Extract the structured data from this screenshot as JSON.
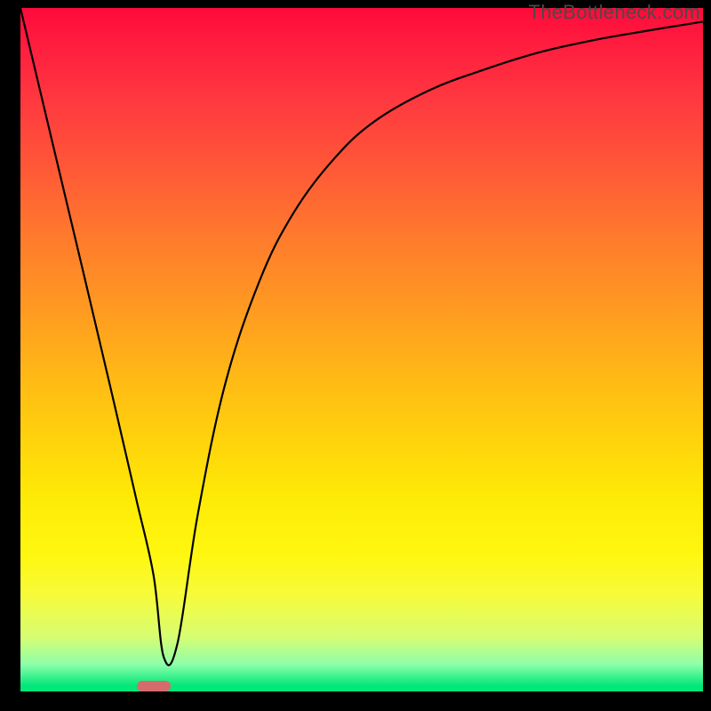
{
  "watermark": {
    "text": "TheBottleneck.com"
  },
  "chart_data": {
    "type": "line",
    "title": "",
    "xlabel": "",
    "ylabel": "",
    "xlim": [
      0,
      100
    ],
    "ylim": [
      0,
      100
    ],
    "grid": false,
    "series": [
      {
        "name": "curve",
        "x": [
          0,
          5,
          10,
          14,
          17,
          19.5,
          21,
          23,
          26,
          30,
          35,
          40,
          46,
          52,
          60,
          68,
          76,
          84,
          92,
          100
        ],
        "values": [
          100,
          79,
          58,
          41,
          28,
          17,
          5,
          7,
          26,
          45,
          60,
          70,
          78,
          83.5,
          88,
          91,
          93.5,
          95.3,
          96.7,
          98
        ]
      }
    ],
    "annotations": {
      "marker": {
        "x_center": 19.5,
        "width_frac": 0.05,
        "color": "#d66b6b"
      }
    },
    "background": "red-yellow-green vertical gradient"
  }
}
